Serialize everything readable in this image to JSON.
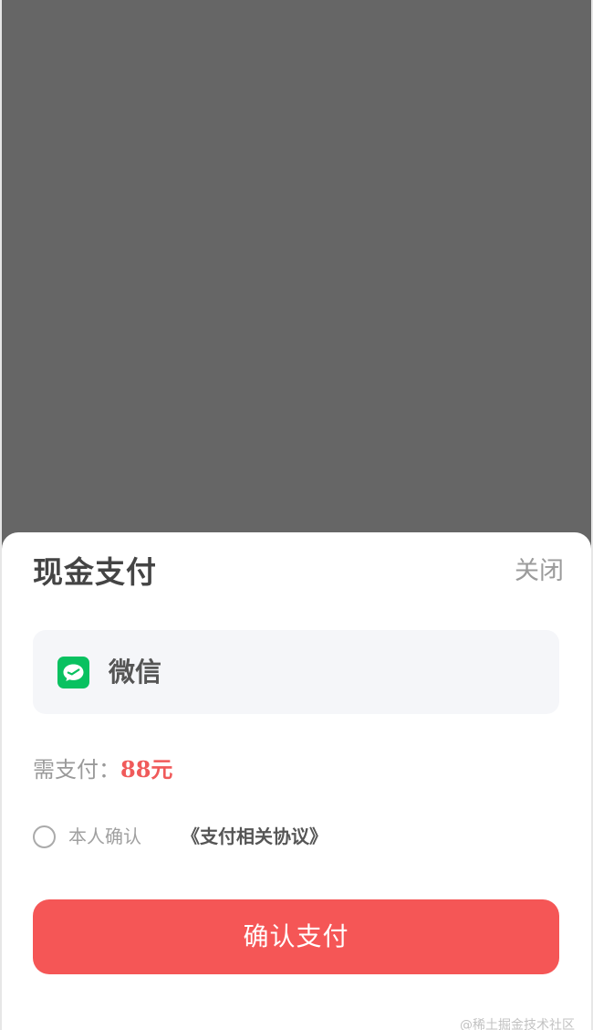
{
  "sheet": {
    "title": "现金支付",
    "close_label": "关闭"
  },
  "payment_method": {
    "label": "微信",
    "icon": "wechat-icon",
    "icon_color": "#09c160"
  },
  "amount": {
    "label": "需支付：",
    "value": "88元"
  },
  "agreement": {
    "checked": false,
    "text": "本人确认",
    "link": "《支付相关协议》"
  },
  "confirm_button": {
    "label": "确认支付",
    "color": "#f55656"
  },
  "watermark": "@稀土掘金技术社区"
}
